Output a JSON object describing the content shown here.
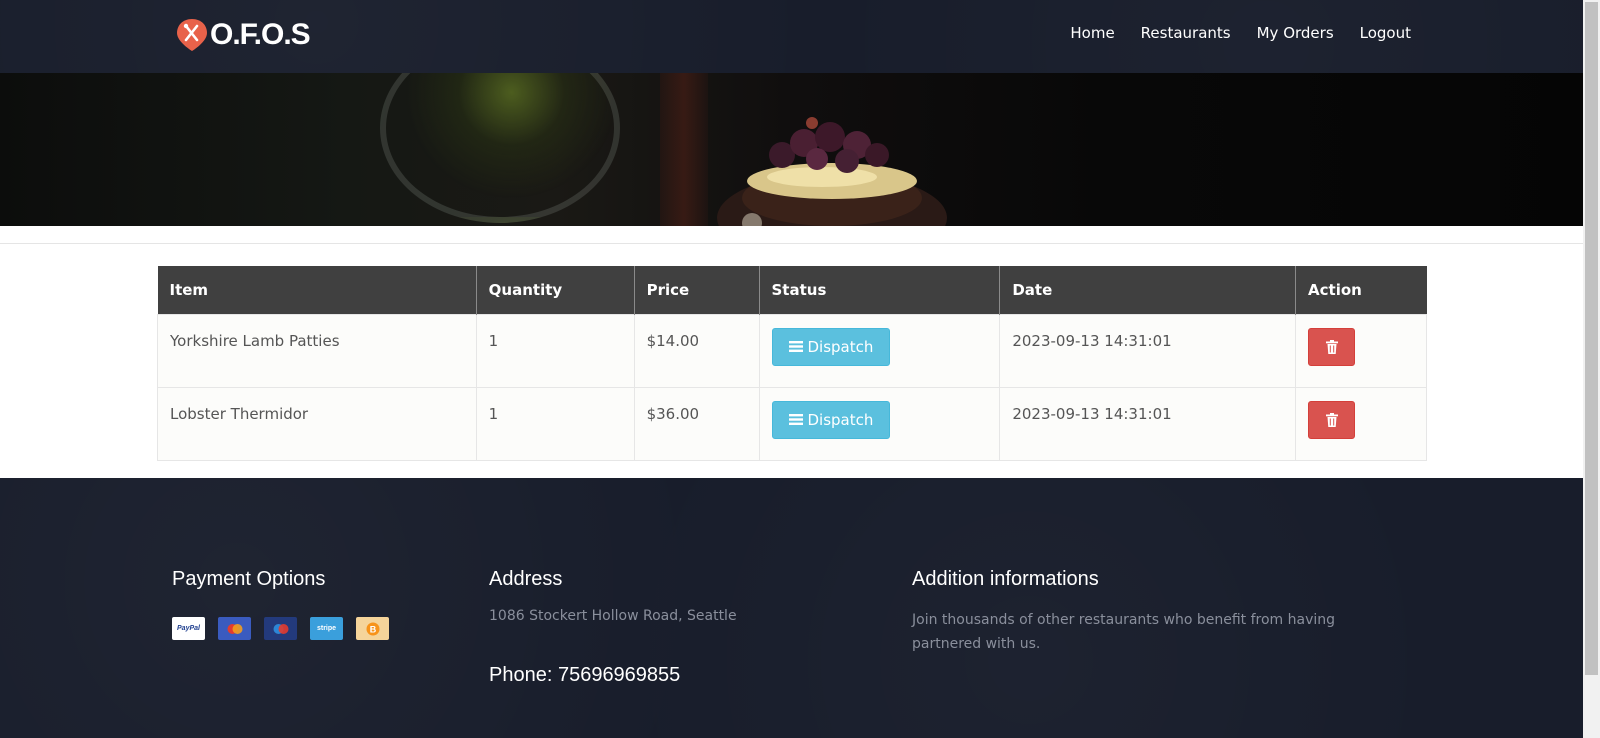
{
  "brand": {
    "name": "O.F.O.S"
  },
  "nav": {
    "items": [
      {
        "label": "Home"
      },
      {
        "label": "Restaurants"
      },
      {
        "label": "My Orders"
      },
      {
        "label": "Logout"
      }
    ]
  },
  "orders": {
    "columns": [
      "Item",
      "Quantity",
      "Price",
      "Status",
      "Date",
      "Action"
    ],
    "rows": [
      {
        "item": "Yorkshire Lamb Patties",
        "quantity": "1",
        "price": "$14.00",
        "status": "Dispatch",
        "date": "2023-09-13 14:31:01"
      },
      {
        "item": "Lobster Thermidor",
        "quantity": "1",
        "price": "$36.00",
        "status": "Dispatch",
        "date": "2023-09-13 14:31:01"
      }
    ]
  },
  "footer": {
    "payment_title": "Payment Options",
    "payment_icons": [
      {
        "name": "paypal-icon",
        "label": "PayPal"
      },
      {
        "name": "mastercard-icon",
        "label": ""
      },
      {
        "name": "maestro-icon",
        "label": ""
      },
      {
        "name": "stripe-icon",
        "label": "stripe"
      },
      {
        "name": "bitcoin-icon",
        "label": ""
      }
    ],
    "address_title": "Address",
    "address": "1086 Stockert Hollow Road, Seattle",
    "phone": "Phone: 75696969855",
    "info_title": "Addition informations",
    "info_text": "Join thousands of other restaurants who benefit from having partnered with us."
  },
  "colors": {
    "navbar_bg": "#181d2b",
    "accent_logo": "#e8624a",
    "dispatch_btn": "#5bc0de",
    "delete_btn": "#d9534f",
    "table_header": "#404040"
  }
}
